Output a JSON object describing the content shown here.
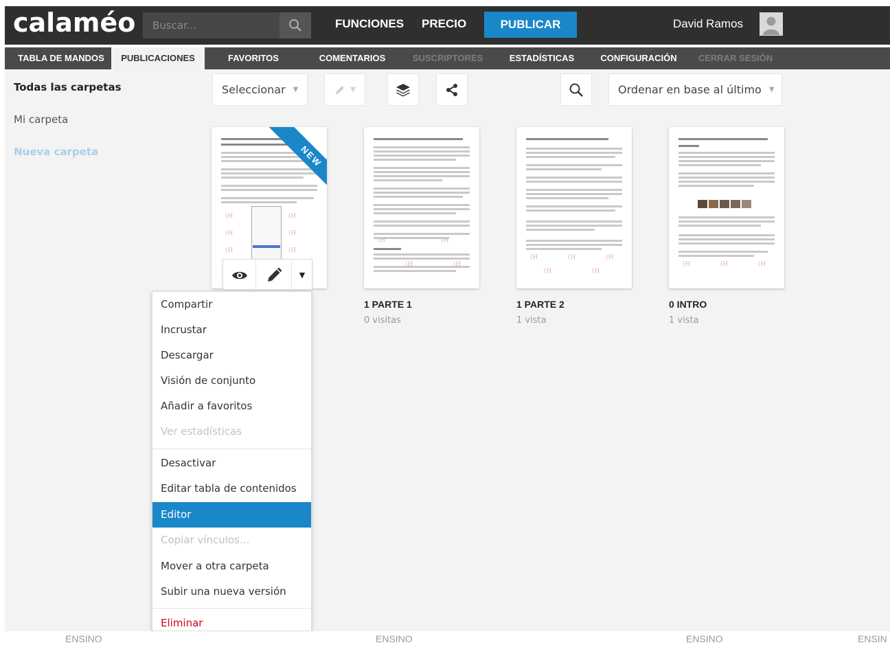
{
  "header": {
    "logo": "calaméo",
    "search_placeholder": "Buscar...",
    "nav": {
      "features": "FUNCIONES",
      "pricing": "PRECIO",
      "publish": "PUBLICAR"
    },
    "user_name": "David Ramos"
  },
  "subnav": {
    "tabs": [
      {
        "label": "TABLA DE MANDOS"
      },
      {
        "label": "PUBLICACIONES"
      },
      {
        "label": "FAVORITOS"
      },
      {
        "label": "COMENTARIOS"
      },
      {
        "label": "SUSCRIPTORES"
      },
      {
        "label": "ESTADÍSTICAS"
      },
      {
        "label": "CONFIGURACIÓN"
      },
      {
        "label": "CERRAR SESIÓN"
      }
    ],
    "active_tab": "PUBLICACIONES"
  },
  "sidebar": {
    "folders": [
      {
        "label": "Todas las carpetas"
      },
      {
        "label": "Mi carpeta"
      },
      {
        "label": "Nueva carpeta"
      }
    ]
  },
  "toolbar": {
    "select_label": "Seleccionar",
    "sort_label": "Ordenar en base al último"
  },
  "publications": [
    {
      "title": "",
      "views": "",
      "badge": "NEW"
    },
    {
      "title": "1 PARTE 1",
      "views": "0 visitas"
    },
    {
      "title": "1 PARTE 2",
      "views": "1 vista"
    },
    {
      "title": "0 INTRO",
      "views": "1 vista"
    }
  ],
  "context_menu": {
    "items": [
      {
        "label": "Compartir",
        "state": "enabled"
      },
      {
        "label": "Incrustar",
        "state": "enabled"
      },
      {
        "label": "Descargar",
        "state": "enabled"
      },
      {
        "label": "Visión de conjunto",
        "state": "enabled"
      },
      {
        "label": "Añadir a favoritos",
        "state": "enabled"
      },
      {
        "label": "Ver estadísticas",
        "state": "disabled"
      },
      {
        "label": "Desactivar",
        "state": "enabled"
      },
      {
        "label": "Editar tabla de contenidos",
        "state": "enabled"
      },
      {
        "label": "Editor",
        "state": "selected"
      },
      {
        "label": "Copiar vínculos...",
        "state": "disabled"
      },
      {
        "label": "Mover a otra carpeta",
        "state": "enabled"
      },
      {
        "label": "Subir una nueva versión",
        "state": "enabled"
      },
      {
        "label": "Eliminar",
        "state": "danger"
      }
    ]
  },
  "footer": {
    "labels": [
      "ENSINO",
      "ENSINO",
      "ENSINO",
      "ENSIN"
    ]
  },
  "colors": {
    "topbar": "#2f2f2f",
    "subbar": "#4a4a4a",
    "accent": "#1a87c9",
    "danger": "#d0021b"
  }
}
